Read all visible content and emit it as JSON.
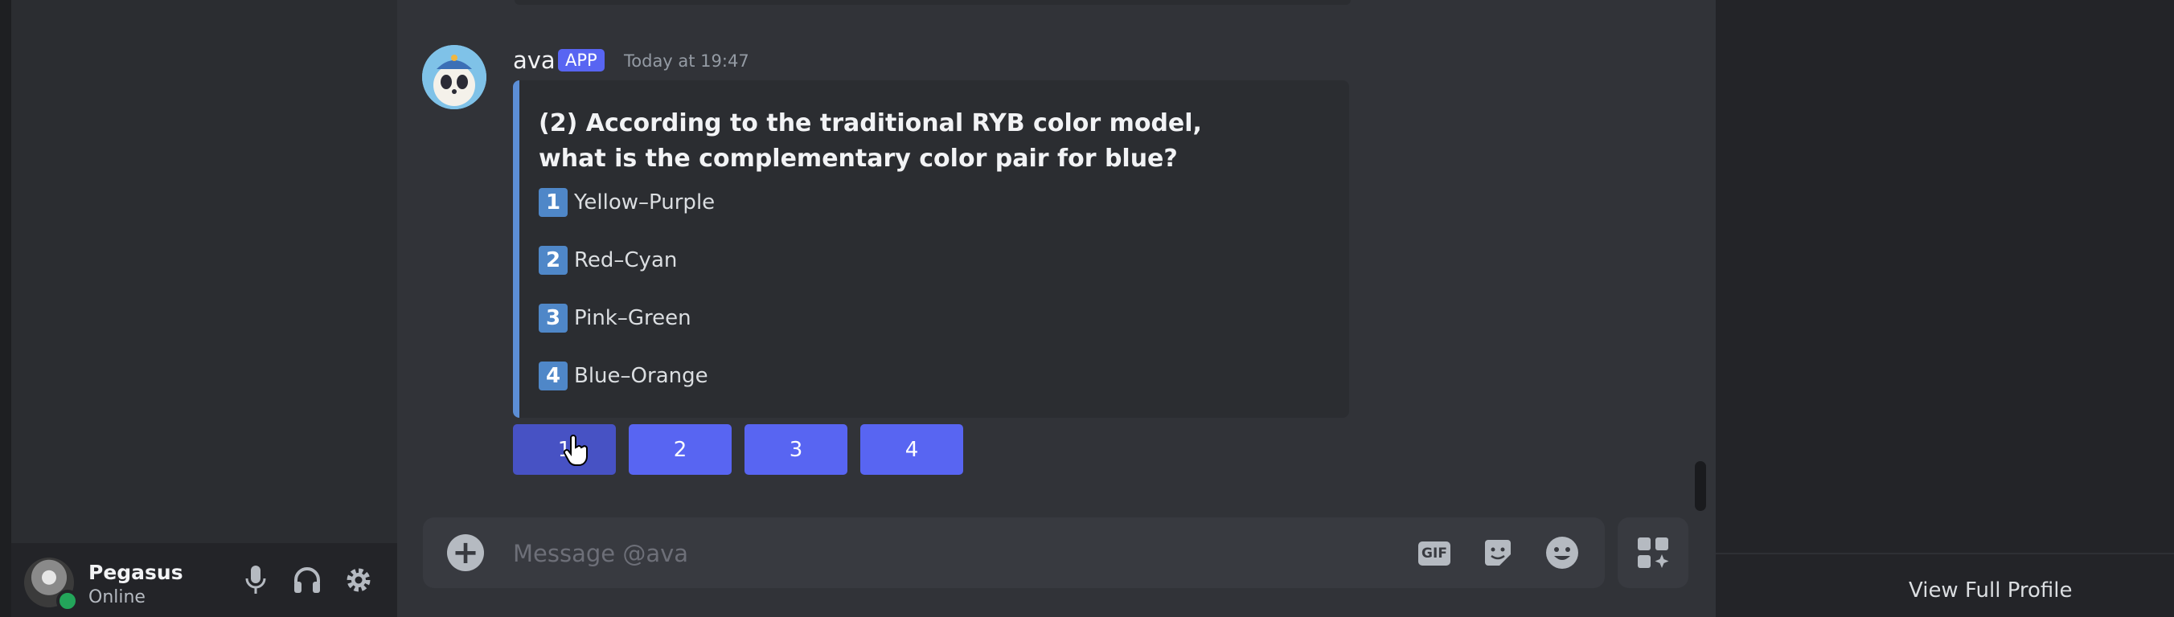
{
  "user_panel": {
    "name": "Pegasus",
    "status": "Online",
    "controls": [
      "microphone-icon",
      "headphones-icon",
      "gear-icon"
    ]
  },
  "message": {
    "author": "ava",
    "tag": "APP",
    "timestamp": "Today at 19:47",
    "embed": {
      "title": "(2) According to the traditional RYB color model, what is the complementary color pair for blue?",
      "options": [
        {
          "badge": "1",
          "text": "Yellow–Purple"
        },
        {
          "badge": "2",
          "text": "Red–Cyan"
        },
        {
          "badge": "3",
          "text": "Pink–Green"
        },
        {
          "badge": "4",
          "text": "Blue–Orange"
        }
      ],
      "accent_color": "#5c8ed6"
    },
    "buttons": [
      "1",
      "2",
      "3",
      "4"
    ]
  },
  "composer": {
    "placeholder": "Message @ava",
    "gif_label": "GIF"
  },
  "profile_panel": {
    "view_full_profile": "View Full Profile"
  },
  "colors": {
    "blurple": "#5865f2",
    "online": "#23a55a"
  }
}
